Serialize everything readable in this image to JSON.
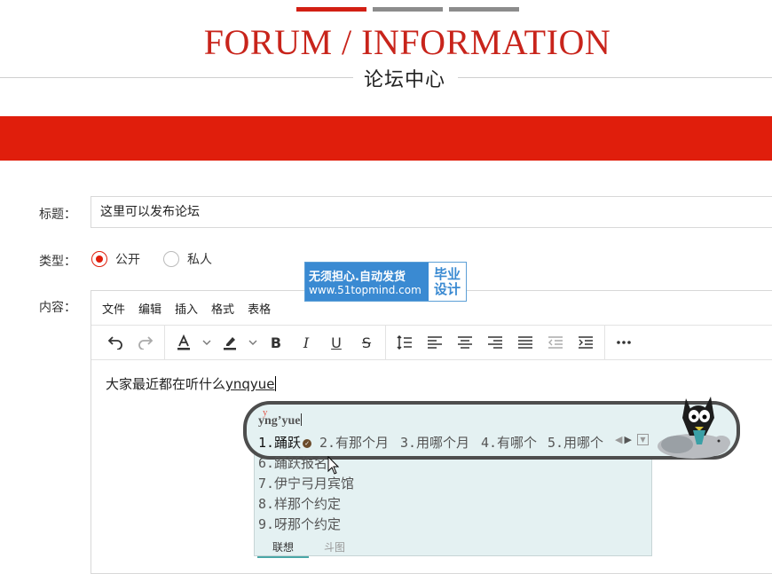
{
  "header": {
    "heading_en": "FORUM / INFORMATION",
    "heading_cn": "论坛中心",
    "accent_color": "#e01e0c"
  },
  "form": {
    "title_label": "标题：",
    "title_value": "这里可以发布论坛",
    "type_label": "类型：",
    "type_options": [
      {
        "label": "公开",
        "checked": true
      },
      {
        "label": "私人",
        "checked": false
      }
    ],
    "content_label": "内容："
  },
  "editor": {
    "menus": [
      "文件",
      "编辑",
      "插入",
      "格式",
      "表格"
    ],
    "toolbar_icons": [
      "undo-icon",
      "redo-icon",
      "font-color-icon",
      "highlight-icon",
      "bold-icon",
      "italic-icon",
      "underline-icon",
      "strikethrough-icon",
      "line-height-icon",
      "align-left-icon",
      "align-center-icon",
      "align-right-icon",
      "justify-icon",
      "outdent-icon",
      "indent-icon",
      "more-icon"
    ],
    "content_prefix": "大家最近都在听什么",
    "composition": "ynqyue"
  },
  "watermark": {
    "line1": "无须担心.自动发货",
    "line2": "www.51topmind.com",
    "right_line1": "毕业",
    "right_line2": "设计"
  },
  "ime": {
    "pinyin": "yng’yue",
    "correction_mark": "y",
    "candidates": [
      "1.踊跃",
      "2.有那个月",
      "3.用哪个月",
      "4.有哪个",
      "5.用哪个",
      "6.踊跃报名",
      "7.伊宁弓月宾馆",
      "8.样那个约定",
      "9.呀那个约定"
    ],
    "tabs": [
      {
        "label": "联想",
        "active": true
      },
      {
        "label": "斗图",
        "active": false
      }
    ]
  }
}
